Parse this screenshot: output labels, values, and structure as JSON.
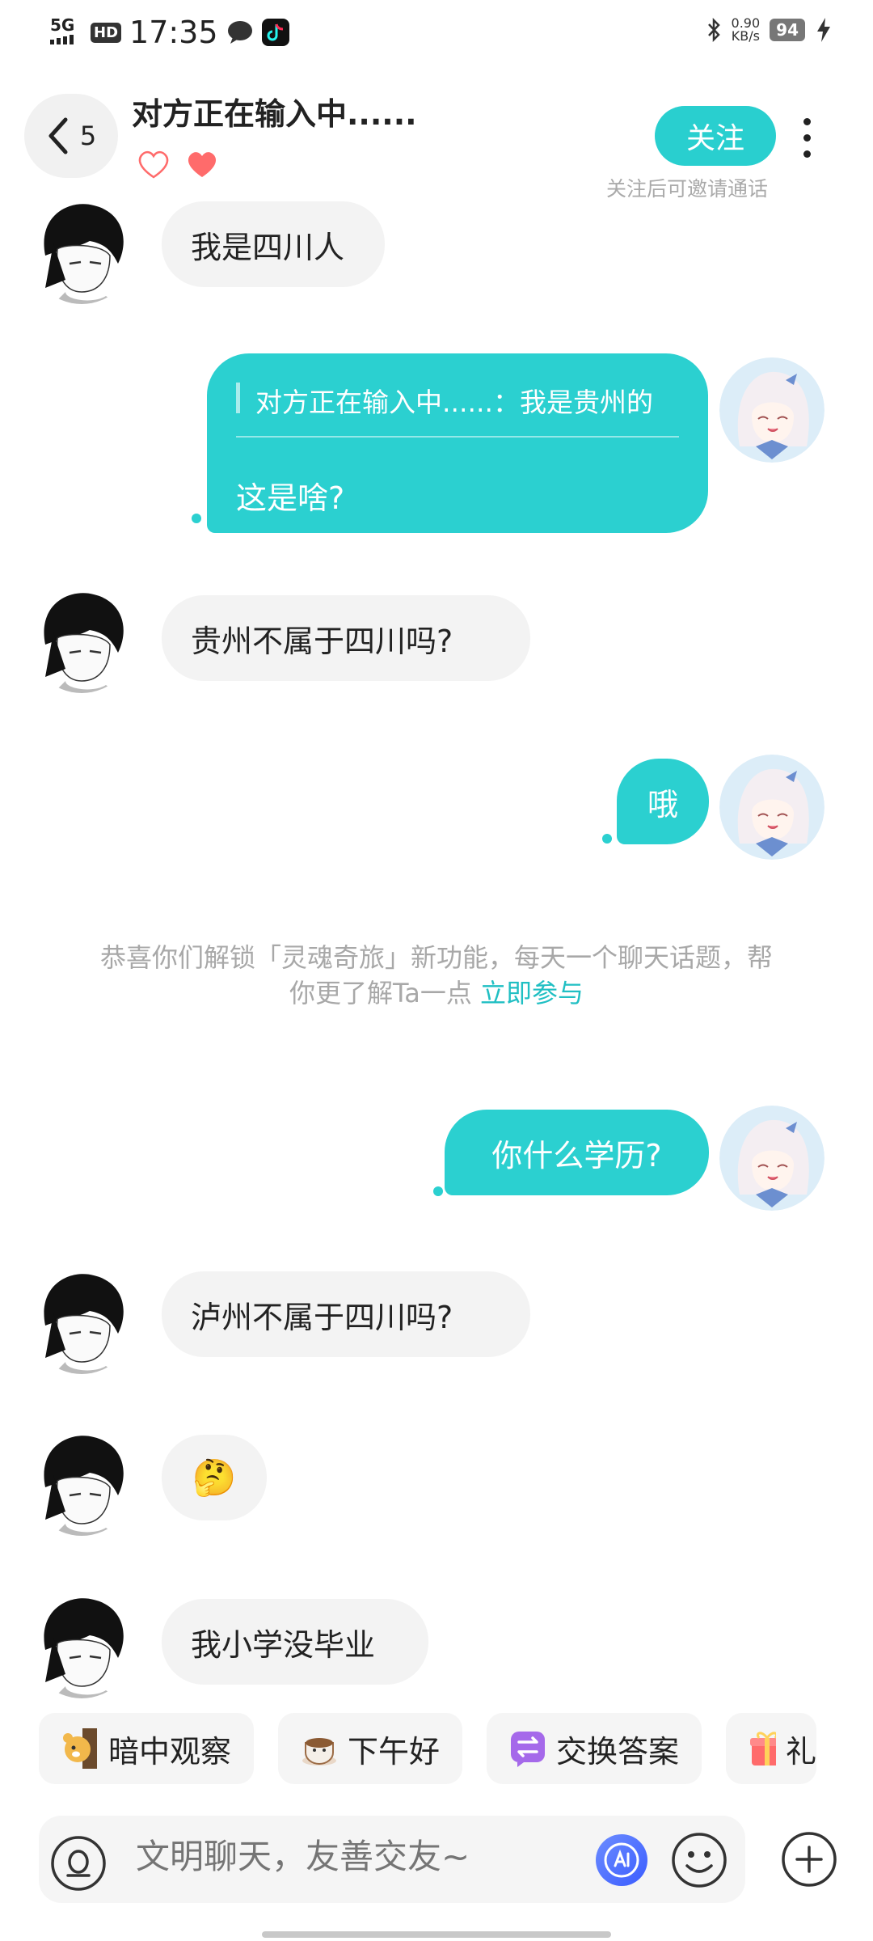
{
  "status_bar": {
    "network": "5G",
    "hd": "HD",
    "time": "17:35",
    "speed_value": "0.90",
    "speed_unit": "KB/s",
    "battery": "94"
  },
  "header": {
    "back_count": "5",
    "title": "对方正在输入中......",
    "follow_label": "关注",
    "follow_hint": "关注后可邀请通话"
  },
  "messages": {
    "m1": "我是四川人",
    "m2_quote": "对方正在输入中......：我是贵州的",
    "m2_reply": "这是啥?",
    "m3": "贵州不属于四川吗?",
    "m4": "哦",
    "system_text": "恭喜你们解锁「灵魂奇旅」新功能，每天一个聊天话题，帮你更了解Ta一点",
    "system_link": "立即参与",
    "m5": "你什么学历?",
    "m6": "泸州不属于四川吗?",
    "m7": "🤔",
    "m8": "我小学没毕业"
  },
  "chips": [
    "暗中观察",
    "下午好",
    "交换答案",
    "礼"
  ],
  "input": {
    "placeholder": "文明聊天，友善交友~"
  },
  "colors": {
    "accent": "#2bd0d0",
    "link": "#20bfc3",
    "heart": "#ff6b6b"
  }
}
